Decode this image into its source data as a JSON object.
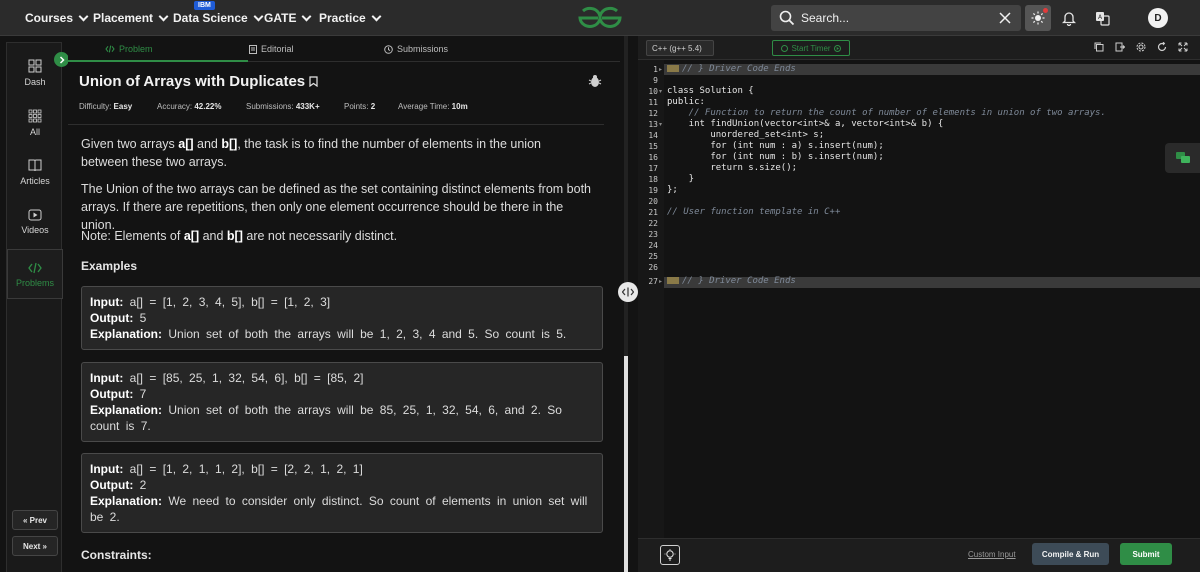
{
  "nav": {
    "items": [
      {
        "label": "Courses"
      },
      {
        "label": "Placement"
      },
      {
        "label": "Data Science",
        "badge": "IBM"
      },
      {
        "label": "GATE"
      },
      {
        "label": "Practice"
      }
    ],
    "search_placeholder": "Search...",
    "avatar_letter": "D"
  },
  "sidebar": {
    "items": [
      {
        "label": "Dash",
        "icon": "dashboard-icon"
      },
      {
        "label": "All",
        "icon": "grid-icon"
      },
      {
        "label": "Articles",
        "icon": "book-icon"
      },
      {
        "label": "Videos",
        "icon": "video-icon"
      },
      {
        "label": "Problems",
        "icon": "code-icon",
        "active": true
      }
    ],
    "prev_label": "« Prev",
    "next_label": "Next »"
  },
  "tabs": [
    {
      "label": "Problem",
      "icon": "code-icon"
    },
    {
      "label": "Editorial",
      "icon": "document-icon"
    },
    {
      "label": "Submissions",
      "icon": "clock-icon"
    }
  ],
  "problem": {
    "title": "Union of Arrays with Duplicates",
    "difficulty_label": "Difficulty:",
    "difficulty": "Easy",
    "accuracy_label": "Accuracy:",
    "accuracy": "42.22%",
    "submissions_label": "Submissions:",
    "submissions": "433K+",
    "points_label": "Points:",
    "points": "2",
    "avg_time_label": "Average Time:",
    "avg_time": "10m",
    "desc1_a": "Given two arrays ",
    "desc1_b": "a[]",
    "desc1_c": " and ",
    "desc1_d": "b[]",
    "desc1_e": ", the task is to find the number of elements in the union between these two arrays.",
    "desc2": "The Union of the two arrays can be defined as the set containing distinct elements from both arrays. If there are repetitions, then only one element occurrence should be there in the union.",
    "note_a": "Note: Elements of ",
    "note_b": "a[]",
    "note_c": " and ",
    "note_d": "b[]",
    "note_e": " are not necessarily distinct.",
    "examples_heading": "Examples",
    "examples": [
      {
        "input": "a[] = [1, 2, 3, 4, 5], b[] = [1, 2, 3]",
        "output": "5",
        "explanation": "Union set of both the arrays will be 1, 2, 3, 4 and 5. So count is 5."
      },
      {
        "input": "a[] = [85, 25, 1, 32, 54, 6], b[] = [85, 2]",
        "output": "7",
        "explanation": "Union set of both the arrays will be 85, 25, 1, 32, 54, 6, and 2. So count is 7."
      },
      {
        "input": "a[] = [1, 2, 1, 1, 2], b[] = [2, 2, 1, 2, 1]",
        "output": "2",
        "explanation": "We need to consider only distinct. So count of elements in union set will be 2."
      }
    ],
    "input_label": "Input:",
    "output_label": "Output:",
    "explanation_label": "Explanation:",
    "constraints_heading": "Constraints:"
  },
  "editor": {
    "language": "C++ (g++ 5.4)",
    "timer_label": "Start Timer",
    "line_numbers": [
      "1",
      "9",
      "10",
      "11",
      "12",
      "13",
      "14",
      "15",
      "16",
      "17",
      "18",
      "19",
      "20",
      "21",
      "22",
      "23",
      "24",
      "25",
      "26",
      "27"
    ],
    "lines": [
      "// } Driver Code Ends",
      "",
      "class Solution {",
      "public:",
      "    // Function to return the count of number of elements in union of two arrays.",
      "    int findUnion(vector<int>& a, vector<int>& b) {",
      "        unordered_set<int> s;",
      "        for (int num : a) s.insert(num);",
      "        for (int num : b) s.insert(num);",
      "        return s.size();",
      "    }",
      "};",
      "",
      "// User function template in C++",
      "",
      "",
      "",
      "",
      "",
      "// } Driver Code Ends"
    ],
    "custom_input_label": "Custom Input",
    "compile_label": "Compile & Run",
    "submit_label": "Submit"
  }
}
